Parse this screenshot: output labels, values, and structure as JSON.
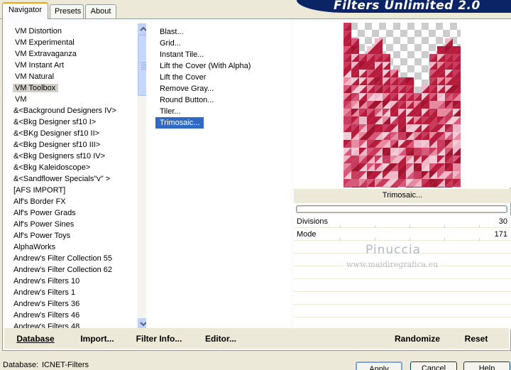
{
  "tabs": [
    {
      "label": "Navigator"
    },
    {
      "label": "Presets"
    },
    {
      "label": "About"
    }
  ],
  "title": "Filters Unlimited 2.0",
  "categories": [
    "VM Distortion",
    "VM Experimental",
    "VM Extravaganza",
    "VM Instant Art",
    "VM Natural",
    "VM Toolbox",
    "VM",
    "&<Background Designers IV>",
    "&<Bkg Designer sf10 I>",
    "&<BKg Designer sf10 II>",
    "&<Bkg Designer sf10 III>",
    "&<Bkg Designers sf10 IV>",
    "&<Bkg Kaleidoscope>",
    "&<Sandflower Specials\"v\" >",
    "[AFS IMPORT]",
    "Alf's Border FX",
    "Alf's Power Grads",
    "Alf's Power Sines",
    "Alf's Power Toys",
    "AlphaWorks",
    "Andrew's Filter Collection 55",
    "Andrew's Filter Collection 62",
    "Andrew's Filters 10",
    "Andrew's Filters 1",
    "Andrew's Filters 36",
    "Andrew's Filters 46",
    "Andrew's Filters 48"
  ],
  "selected_category": "VM Toolbox",
  "filters": [
    "Blast...",
    "Grid...",
    "Instant Tile...",
    "Lift the Cover (With Alpha)",
    "Lift the Cover",
    "Remove Gray...",
    "Round Button...",
    "Tiler...",
    "Trimosaic..."
  ],
  "selected_filter": "Trimosaic...",
  "preview": {
    "filter_name": "Trimosaic...",
    "progress": 0,
    "colors": {
      "dark": "#b81c3c",
      "mid": "#d8587a",
      "light": "#efb8c8",
      "checker": "#cccccc"
    }
  },
  "params": [
    {
      "name": "Divisions",
      "value": "30",
      "level": 0.118
    },
    {
      "name": "Mode",
      "value": "171",
      "level": 0.671
    }
  ],
  "watermark": {
    "name": "Pinuccia",
    "url": "www.maidiregrafica.eu"
  },
  "buttons": {
    "database": "Database",
    "import": "Import...",
    "filter_info": "Filter Info...",
    "editor": "Editor...",
    "randomize": "Randomize",
    "reset": "Reset"
  },
  "status": {
    "label": "Database:",
    "value": "ICNET-Filters"
  },
  "dialog_buttons": {
    "apply": "Apply",
    "cancel": "Cancel",
    "help": "Help"
  }
}
